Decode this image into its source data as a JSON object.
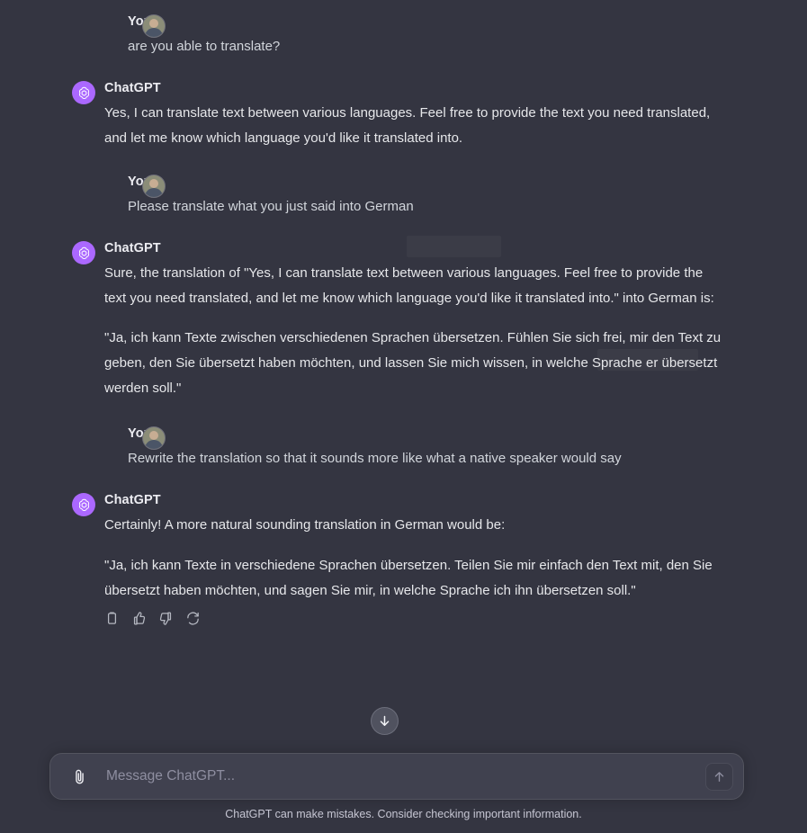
{
  "app": {
    "assistant_name": "ChatGPT",
    "user_name": "You",
    "accent_color": "#ab68ff",
    "background_color": "#343541",
    "composer_background": "#40414f"
  },
  "conversation": {
    "messages": [
      {
        "role": "user",
        "author": "You",
        "avatar_icon": "user-photo-avatar",
        "paragraphs": [
          "are you able to translate?"
        ]
      },
      {
        "role": "assistant",
        "author": "ChatGPT",
        "avatar_icon": "openai-logo-icon",
        "paragraphs": [
          "Yes, I can translate text between various languages. Feel free to provide the text you need translated, and let me know which language you'd like it translated into."
        ]
      },
      {
        "role": "user",
        "author": "You",
        "avatar_icon": "user-photo-avatar",
        "paragraphs": [
          "Please translate what you just said into German"
        ]
      },
      {
        "role": "assistant",
        "author": "ChatGPT",
        "avatar_icon": "openai-logo-icon",
        "paragraphs": [
          "Sure, the translation of \"Yes, I can translate text between various languages. Feel free to provide the text you need translated, and let me know which language you'd like it translated into.\" into German is:",
          "\"Ja, ich kann Texte zwischen verschiedenen Sprachen übersetzen. Fühlen Sie sich frei, mir den Text zu geben, den Sie übersetzt haben möchten, und lassen Sie mich wissen, in welche Sprache er übersetzt werden soll.\""
        ]
      },
      {
        "role": "user",
        "author": "You",
        "avatar_icon": "user-photo-avatar",
        "paragraphs": [
          "Rewrite the translation so that it sounds more like what a native speaker would say"
        ]
      },
      {
        "role": "assistant",
        "author": "ChatGPT",
        "avatar_icon": "openai-logo-icon",
        "paragraphs": [
          "Certainly! A more natural sounding translation in German would be:",
          "\"Ja, ich kann Texte in verschiedene Sprachen übersetzen. Teilen Sie mir einfach den Text mit, den Sie übersetzt haben möchten, und sagen Sie mir, in welche Sprache ich ihn übersetzen soll.\""
        ]
      }
    ]
  },
  "message_actions": [
    {
      "name": "copy-icon",
      "label": "Copy"
    },
    {
      "name": "thumbs-up-icon",
      "label": "Good response"
    },
    {
      "name": "thumbs-down-icon",
      "label": "Bad response"
    },
    {
      "name": "regenerate-icon",
      "label": "Regenerate"
    }
  ],
  "scroll_button": {
    "icon": "arrow-down-icon",
    "label": "Scroll to bottom"
  },
  "composer": {
    "attach_icon": "paperclip-icon",
    "placeholder": "Message ChatGPT...",
    "value": "",
    "send_icon": "arrow-up-icon",
    "send_label": "Send message"
  },
  "footer": {
    "disclaimer": "ChatGPT can make mistakes. Consider checking important information."
  }
}
